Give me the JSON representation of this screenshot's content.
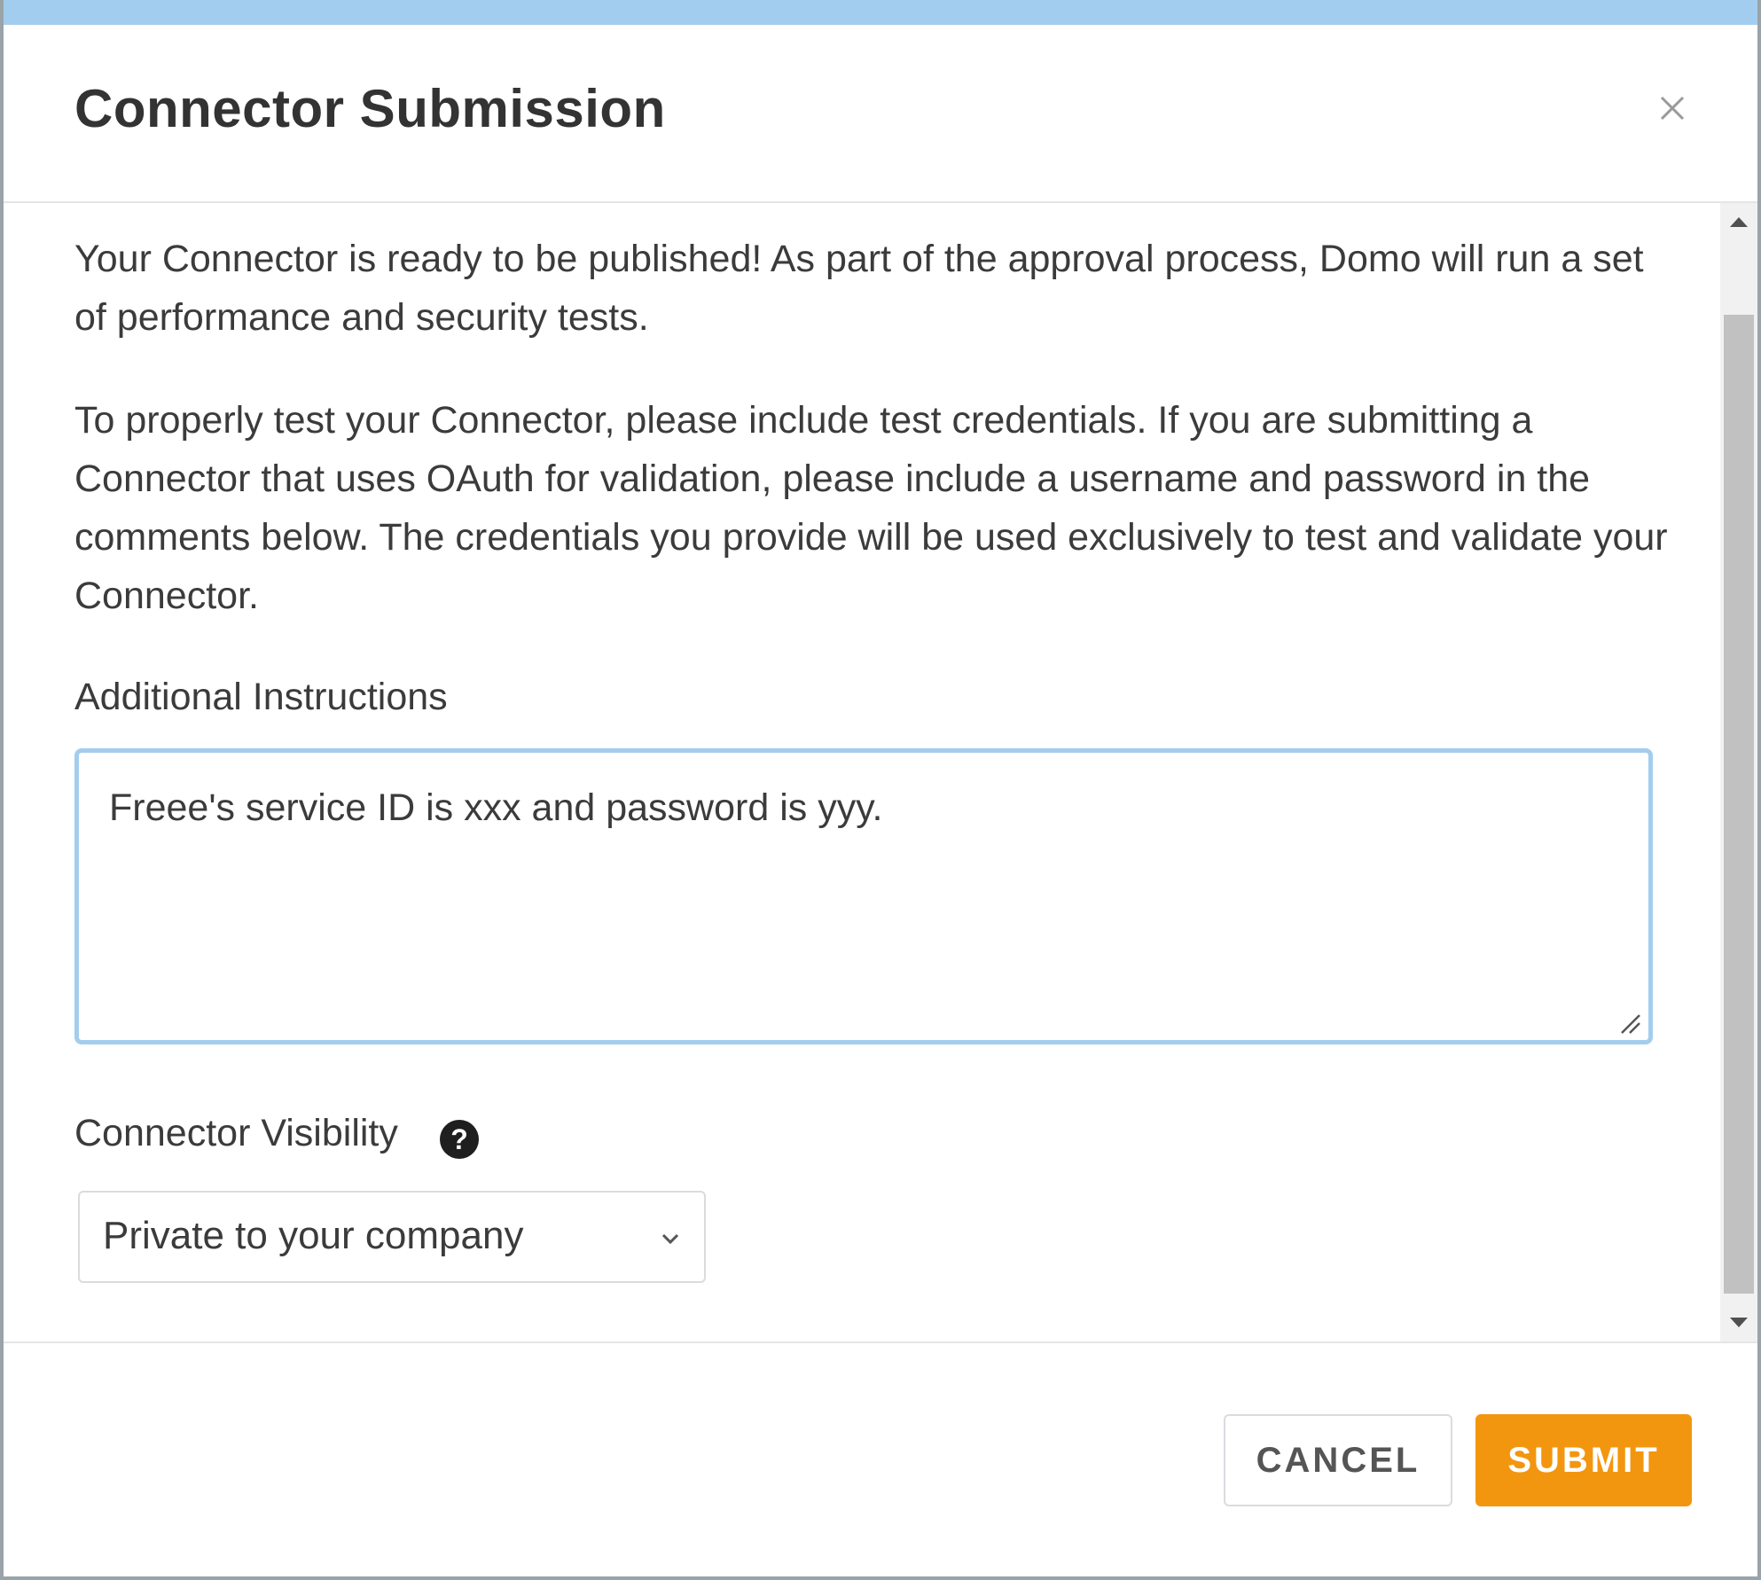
{
  "dialog": {
    "title": "Connector Submission",
    "close_icon": "close-icon"
  },
  "body": {
    "paragraph_1": "Your Connector is ready to be published! As part of the approval process, Domo will run a set of performance and security tests.",
    "paragraph_2": "To properly test your Connector, please include test credentials. If you are submitting a Connector that uses OAuth for validation, please include a username and password in the comments below. The credentials you provide will be used exclusively to test and validate your Connector.",
    "instructions_label": "Additional Instructions",
    "instructions_value": "Freee's service ID is xxx and password is yyy.",
    "visibility_label": "Connector Visibility",
    "help_icon_glyph": "?",
    "visibility_selected": "Private to your company"
  },
  "footer": {
    "cancel_label": "CANCEL",
    "submit_label": "SUBMIT"
  },
  "colors": {
    "accent_border": "#a3cdee",
    "submit_bg": "#f3960f"
  }
}
